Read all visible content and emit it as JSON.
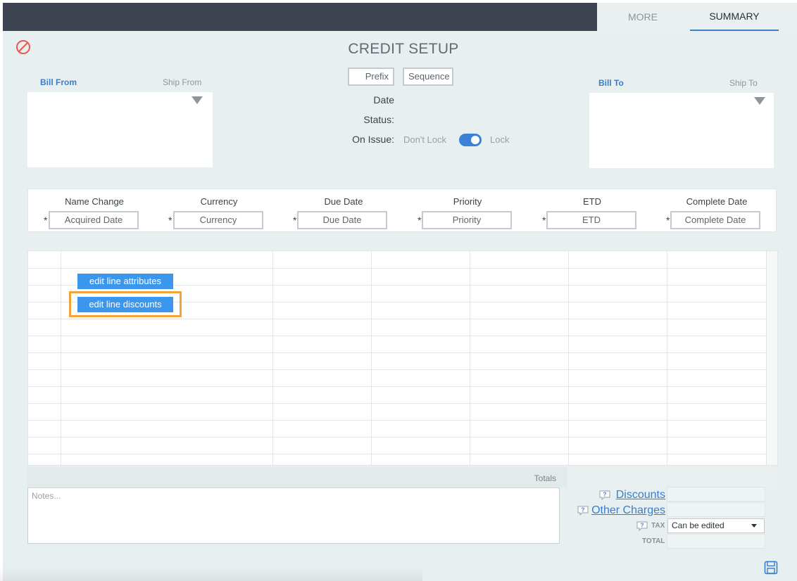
{
  "tabs": {
    "more": "MORE",
    "summary": "SUMMARY"
  },
  "header": {
    "title": "CREDIT SETUP"
  },
  "bill_from": {
    "active_label": "Bill From",
    "alt_label": "Ship From"
  },
  "bill_to": {
    "active_label": "Bill To",
    "alt_label": "Ship To"
  },
  "numbering": {
    "prefix_placeholder": "Prefix",
    "sequence_placeholder": "Sequence"
  },
  "meta": {
    "date_label": "Date",
    "status_label": "Status:",
    "on_issue_label": "On Issue:",
    "dont_lock_label": "Don't Lock",
    "lock_label": "Lock",
    "lock_enabled": true
  },
  "fields": [
    {
      "header": "Name Change",
      "placeholder": "Acquired Date",
      "required": "*"
    },
    {
      "header": "Currency",
      "placeholder": "Currency",
      "required": "*"
    },
    {
      "header": "Due Date",
      "placeholder": "Due Date",
      "required": "*"
    },
    {
      "header": "Priority",
      "placeholder": "Priority",
      "required": "*"
    },
    {
      "header": "ETD",
      "placeholder": "ETD",
      "required": "*"
    },
    {
      "header": "Complete Date",
      "placeholder": "Complete Date",
      "required": "*"
    }
  ],
  "line_actions": {
    "edit_attributes": "edit line attributes",
    "edit_discounts": "edit line discounts"
  },
  "totals": {
    "label": "Totals",
    "discounts_label": "Discounts",
    "other_charges_label": "Other Charges",
    "tax_label": "TAX",
    "tax_value": "Can be edited",
    "total_label": "TOTAL"
  },
  "notes": {
    "placeholder": "Notes..."
  },
  "colors": {
    "accent": "#3a7ec8",
    "button": "#3b97ee",
    "highlight": "#f4a33a",
    "cancel": "#e85a4f"
  },
  "icons": {
    "cancel": "cancel-circle-icon",
    "dropdown": "dropdown-triangle-icon",
    "help": "help-bubble-icon",
    "save": "save-icon"
  }
}
